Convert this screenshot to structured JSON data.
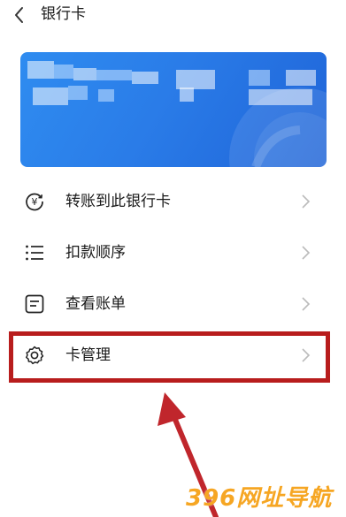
{
  "header": {
    "title": "银行卡"
  },
  "menu": [
    {
      "label": "转账到此银行卡",
      "icon": "yuan-transfer-icon"
    },
    {
      "label": "扣款顺序",
      "icon": "list-icon"
    },
    {
      "label": "查看账单",
      "icon": "bill-icon"
    },
    {
      "label": "卡管理",
      "icon": "gear-icon"
    }
  ],
  "watermark": "396网址导航",
  "colors": {
    "card": "#2a7ce8",
    "highlight": "#b81d1d",
    "arrow": "#c0262c",
    "watermark": "#f6a623"
  }
}
